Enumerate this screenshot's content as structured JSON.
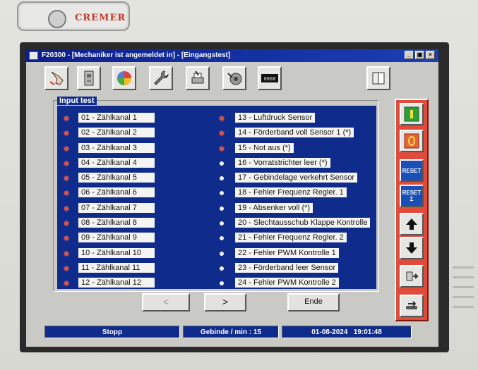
{
  "brand": {
    "name": "CREMER"
  },
  "window": {
    "title": "F20300 - [Mechaniker ist angemeldet in] - [Eingangstest]",
    "controls": [
      "_",
      "▣",
      "×"
    ]
  },
  "toolbar": {
    "buttons": [
      {
        "icon": "hand-pointer-icon"
      },
      {
        "icon": "cabinet-icon"
      },
      {
        "icon": "color-wheel-icon"
      },
      {
        "icon": "wrench-icon"
      },
      {
        "icon": "printer-hand-icon"
      },
      {
        "icon": "hand-dial-icon"
      },
      {
        "icon": "digital-counter-icon",
        "text": "8888"
      },
      {
        "icon": "book-icon"
      }
    ]
  },
  "input_test": {
    "label": "Input test",
    "left": [
      {
        "label": "01 - Zählkanal  1",
        "state": "red"
      },
      {
        "label": "02 - Zählkanal  2",
        "state": "red"
      },
      {
        "label": "03 - Zählkanal  3",
        "state": "red"
      },
      {
        "label": "04 - Zählkanal  4",
        "state": "red"
      },
      {
        "label": "05 - Zählkanal  5",
        "state": "red"
      },
      {
        "label": "06 - Zählkanal  6",
        "state": "red"
      },
      {
        "label": "07 - Zählkanal  7",
        "state": "red"
      },
      {
        "label": "08 - Zählkanal  8",
        "state": "red"
      },
      {
        "label": "09 - Zählkanal  9",
        "state": "red"
      },
      {
        "label": "10 - Zählkanal 10",
        "state": "red"
      },
      {
        "label": "11 - Zählkanal 11",
        "state": "red"
      },
      {
        "label": "12 - Zählkanal 12",
        "state": "red"
      }
    ],
    "right": [
      {
        "label": "13 - Luftdruck Sensor",
        "state": "red"
      },
      {
        "label": "14 - Förderband voll Sensor 1 (*)",
        "state": "red"
      },
      {
        "label": "15 - Not aus (*)",
        "state": "red"
      },
      {
        "label": "16 - Vorratstrichter leer (*)",
        "state": "white"
      },
      {
        "label": "17 - Gebindelage verkehrt Sensor",
        "state": "white"
      },
      {
        "label": "18 - Fehler Frequenz Regler. 1",
        "state": "white"
      },
      {
        "label": "19 - Absenker voll (*)",
        "state": "white"
      },
      {
        "label": "20 - Slechtausschub Klappe Kontrolle",
        "state": "white"
      },
      {
        "label": "21 - Fehler Frequenz Regler. 2",
        "state": "white"
      },
      {
        "label": "22 - Fehler PWM Kontrolle 1",
        "state": "white"
      },
      {
        "label": "23 - Förderband leer Sensor",
        "state": "white"
      },
      {
        "label": "24 - Fehler PWM Kontrolle 2",
        "state": "white"
      }
    ]
  },
  "nav": {
    "prev": "<",
    "next": ">",
    "end": "Ende"
  },
  "status": {
    "state": "Stopp",
    "rate_label": "Gebinde  / min :",
    "rate_value": "15",
    "date": "01-08-2024",
    "time": "19:01:48"
  },
  "side_buttons": [
    {
      "icon": "start-icon",
      "color": "#2e9e3a"
    },
    {
      "icon": "stop-icon",
      "color": "#d9432f"
    },
    {
      "icon": "reset-icon",
      "text": "RESET"
    },
    {
      "icon": "reset-sum-icon",
      "text": "RESET Σ"
    },
    {
      "icon": "arrow-up-icon"
    },
    {
      "icon": "arrow-down-icon"
    },
    {
      "icon": "transfer-icon"
    },
    {
      "icon": "conveyor-icon"
    }
  ]
}
